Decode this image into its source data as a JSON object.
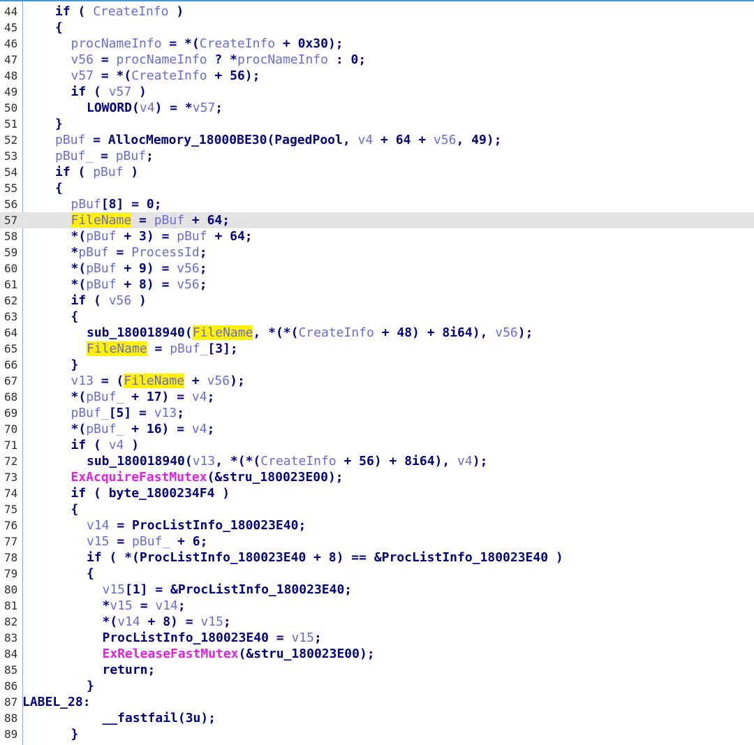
{
  "editor": {
    "colors": {
      "keyword": "#000080",
      "variable": "#6b6bd6",
      "import_function": "#e022e0",
      "highlight": "#fff200",
      "current_line": "#e4e4e4"
    },
    "highlighted_identifier": "FileName",
    "current_line_number": "57",
    "lines": [
      {
        "n": "44",
        "indent": 2,
        "tokens": [
          [
            "kw",
            "if"
          ],
          [
            "punc",
            " ( "
          ],
          [
            "var",
            "CreateInfo"
          ],
          [
            "punc",
            " )"
          ]
        ]
      },
      {
        "n": "45",
        "indent": 2,
        "tokens": [
          [
            "punc",
            "{"
          ]
        ]
      },
      {
        "n": "46",
        "indent": 3,
        "tokens": [
          [
            "var",
            "procNameInfo"
          ],
          [
            "punc",
            " = *("
          ],
          [
            "var",
            "CreateInfo"
          ],
          [
            "punc",
            " + 0x30);"
          ]
        ]
      },
      {
        "n": "47",
        "indent": 3,
        "tokens": [
          [
            "var",
            "v56"
          ],
          [
            "punc",
            " = "
          ],
          [
            "var",
            "procNameInfo"
          ],
          [
            "punc",
            " ? *"
          ],
          [
            "var",
            "procNameInfo"
          ],
          [
            "punc",
            " : 0;"
          ]
        ]
      },
      {
        "n": "48",
        "indent": 3,
        "tokens": [
          [
            "var",
            "v57"
          ],
          [
            "punc",
            " = *("
          ],
          [
            "var",
            "CreateInfo"
          ],
          [
            "punc",
            " + 56);"
          ]
        ]
      },
      {
        "n": "49",
        "indent": 3,
        "tokens": [
          [
            "kw",
            "if"
          ],
          [
            "punc",
            " ( "
          ],
          [
            "var",
            "v57"
          ],
          [
            "punc",
            " )"
          ]
        ]
      },
      {
        "n": "50",
        "indent": 4,
        "tokens": [
          [
            "fn",
            "LOWORD"
          ],
          [
            "punc",
            "("
          ],
          [
            "var",
            "v4"
          ],
          [
            "punc",
            ") = *"
          ],
          [
            "var",
            "v57"
          ],
          [
            "punc",
            ";"
          ]
        ]
      },
      {
        "n": "51",
        "indent": 2,
        "tokens": [
          [
            "punc",
            "}"
          ]
        ]
      },
      {
        "n": "52",
        "indent": 2,
        "tokens": [
          [
            "var",
            "pBuf"
          ],
          [
            "punc",
            " = "
          ],
          [
            "fn",
            "AllocMemory_18000BE30"
          ],
          [
            "punc",
            "("
          ],
          [
            "fn",
            "PagedPool"
          ],
          [
            "punc",
            ", "
          ],
          [
            "var",
            "v4"
          ],
          [
            "punc",
            " + 64 + "
          ],
          [
            "var",
            "v56"
          ],
          [
            "punc",
            ", 49);"
          ]
        ]
      },
      {
        "n": "53",
        "indent": 2,
        "tokens": [
          [
            "var",
            "pBuf_"
          ],
          [
            "punc",
            " = "
          ],
          [
            "var",
            "pBuf"
          ],
          [
            "punc",
            ";"
          ]
        ]
      },
      {
        "n": "54",
        "indent": 2,
        "tokens": [
          [
            "kw",
            "if"
          ],
          [
            "punc",
            " ( "
          ],
          [
            "var",
            "pBuf"
          ],
          [
            "punc",
            " )"
          ]
        ]
      },
      {
        "n": "55",
        "indent": 2,
        "tokens": [
          [
            "punc",
            "{"
          ]
        ]
      },
      {
        "n": "56",
        "indent": 3,
        "tokens": [
          [
            "var",
            "pBuf"
          ],
          [
            "punc",
            "[8] = 0;"
          ]
        ]
      },
      {
        "n": "57",
        "indent": 3,
        "tokens": [
          [
            "hl",
            "FileName"
          ],
          [
            "punc",
            " = "
          ],
          [
            "var",
            "pBuf"
          ],
          [
            "punc",
            " + 64;"
          ]
        ]
      },
      {
        "n": "58",
        "indent": 3,
        "tokens": [
          [
            "punc",
            "*("
          ],
          [
            "var",
            "pBuf"
          ],
          [
            "punc",
            " + 3) = "
          ],
          [
            "var",
            "pBuf"
          ],
          [
            "punc",
            " + 64;"
          ]
        ]
      },
      {
        "n": "59",
        "indent": 3,
        "tokens": [
          [
            "punc",
            "*"
          ],
          [
            "var",
            "pBuf"
          ],
          [
            "punc",
            " = "
          ],
          [
            "var",
            "ProcessId"
          ],
          [
            "punc",
            ";"
          ]
        ]
      },
      {
        "n": "60",
        "indent": 3,
        "tokens": [
          [
            "punc",
            "*("
          ],
          [
            "var",
            "pBuf"
          ],
          [
            "punc",
            " + 9) = "
          ],
          [
            "var",
            "v56"
          ],
          [
            "punc",
            ";"
          ]
        ]
      },
      {
        "n": "61",
        "indent": 3,
        "tokens": [
          [
            "punc",
            "*("
          ],
          [
            "var",
            "pBuf"
          ],
          [
            "punc",
            " + 8) = "
          ],
          [
            "var",
            "v56"
          ],
          [
            "punc",
            ";"
          ]
        ]
      },
      {
        "n": "62",
        "indent": 3,
        "tokens": [
          [
            "kw",
            "if"
          ],
          [
            "punc",
            " ( "
          ],
          [
            "var",
            "v56"
          ],
          [
            "punc",
            " )"
          ]
        ]
      },
      {
        "n": "63",
        "indent": 3,
        "tokens": [
          [
            "punc",
            "{"
          ]
        ]
      },
      {
        "n": "64",
        "indent": 4,
        "tokens": [
          [
            "fn",
            "sub_180018940"
          ],
          [
            "punc",
            "("
          ],
          [
            "hl",
            "FileName"
          ],
          [
            "punc",
            ", *(*("
          ],
          [
            "var",
            "CreateInfo"
          ],
          [
            "punc",
            " + 48) + 8i64), "
          ],
          [
            "var",
            "v56"
          ],
          [
            "punc",
            ");"
          ]
        ]
      },
      {
        "n": "65",
        "indent": 4,
        "tokens": [
          [
            "hl",
            "FileName"
          ],
          [
            "punc",
            " = "
          ],
          [
            "var",
            "pBuf_"
          ],
          [
            "punc",
            "[3];"
          ]
        ]
      },
      {
        "n": "66",
        "indent": 3,
        "tokens": [
          [
            "punc",
            "}"
          ]
        ]
      },
      {
        "n": "67",
        "indent": 3,
        "tokens": [
          [
            "var",
            "v13"
          ],
          [
            "punc",
            " = ("
          ],
          [
            "hl",
            "FileName"
          ],
          [
            "punc",
            " + "
          ],
          [
            "var",
            "v56"
          ],
          [
            "punc",
            ");"
          ]
        ]
      },
      {
        "n": "68",
        "indent": 3,
        "tokens": [
          [
            "punc",
            "*("
          ],
          [
            "var",
            "pBuf_"
          ],
          [
            "punc",
            " + 17) = "
          ],
          [
            "var",
            "v4"
          ],
          [
            "punc",
            ";"
          ]
        ]
      },
      {
        "n": "69",
        "indent": 3,
        "tokens": [
          [
            "var",
            "pBuf_"
          ],
          [
            "punc",
            "[5] = "
          ],
          [
            "var",
            "v13"
          ],
          [
            "punc",
            ";"
          ]
        ]
      },
      {
        "n": "70",
        "indent": 3,
        "tokens": [
          [
            "punc",
            "*("
          ],
          [
            "var",
            "pBuf_"
          ],
          [
            "punc",
            " + 16) = "
          ],
          [
            "var",
            "v4"
          ],
          [
            "punc",
            ";"
          ]
        ]
      },
      {
        "n": "71",
        "indent": 3,
        "tokens": [
          [
            "kw",
            "if"
          ],
          [
            "punc",
            " ( "
          ],
          [
            "var",
            "v4"
          ],
          [
            "punc",
            " )"
          ]
        ]
      },
      {
        "n": "72",
        "indent": 4,
        "tokens": [
          [
            "fn",
            "sub_180018940"
          ],
          [
            "punc",
            "("
          ],
          [
            "var",
            "v13"
          ],
          [
            "punc",
            ", *(*("
          ],
          [
            "var",
            "CreateInfo"
          ],
          [
            "punc",
            " + 56) + 8i64), "
          ],
          [
            "var",
            "v4"
          ],
          [
            "punc",
            ");"
          ]
        ]
      },
      {
        "n": "73",
        "indent": 3,
        "tokens": [
          [
            "imp",
            "ExAcquireFastMutex"
          ],
          [
            "punc",
            "(&stru_180023E00);"
          ]
        ]
      },
      {
        "n": "74",
        "indent": 3,
        "tokens": [
          [
            "kw",
            "if"
          ],
          [
            "punc",
            " ( byte_1800234F4 )"
          ]
        ]
      },
      {
        "n": "75",
        "indent": 3,
        "tokens": [
          [
            "punc",
            "{"
          ]
        ]
      },
      {
        "n": "76",
        "indent": 4,
        "tokens": [
          [
            "var",
            "v14"
          ],
          [
            "punc",
            " = ProcListInfo_180023E40;"
          ]
        ]
      },
      {
        "n": "77",
        "indent": 4,
        "tokens": [
          [
            "var",
            "v15"
          ],
          [
            "punc",
            " = "
          ],
          [
            "var",
            "pBuf_"
          ],
          [
            "punc",
            " + 6;"
          ]
        ]
      },
      {
        "n": "78",
        "indent": 4,
        "tokens": [
          [
            "kw",
            "if"
          ],
          [
            "punc",
            " ( *(ProcListInfo_180023E40 + 8) == &ProcListInfo_180023E40 )"
          ]
        ]
      },
      {
        "n": "79",
        "indent": 4,
        "tokens": [
          [
            "punc",
            "{"
          ]
        ]
      },
      {
        "n": "80",
        "indent": 5,
        "tokens": [
          [
            "var",
            "v15"
          ],
          [
            "punc",
            "[1] = &ProcListInfo_180023E40;"
          ]
        ]
      },
      {
        "n": "81",
        "indent": 5,
        "tokens": [
          [
            "punc",
            "*"
          ],
          [
            "var",
            "v15"
          ],
          [
            "punc",
            " = "
          ],
          [
            "var",
            "v14"
          ],
          [
            "punc",
            ";"
          ]
        ]
      },
      {
        "n": "82",
        "indent": 5,
        "tokens": [
          [
            "punc",
            "*("
          ],
          [
            "var",
            "v14"
          ],
          [
            "punc",
            " + 8) = "
          ],
          [
            "var",
            "v15"
          ],
          [
            "punc",
            ";"
          ]
        ]
      },
      {
        "n": "83",
        "indent": 5,
        "tokens": [
          [
            "punc",
            "ProcListInfo_180023E40 = "
          ],
          [
            "var",
            "v15"
          ],
          [
            "punc",
            ";"
          ]
        ]
      },
      {
        "n": "84",
        "indent": 5,
        "tokens": [
          [
            "imp",
            "ExReleaseFastMutex"
          ],
          [
            "punc",
            "(&stru_180023E00);"
          ]
        ]
      },
      {
        "n": "85",
        "indent": 5,
        "tokens": [
          [
            "kw",
            "return"
          ],
          [
            "punc",
            ";"
          ]
        ]
      },
      {
        "n": "86",
        "indent": 4,
        "tokens": [
          [
            "punc",
            "}"
          ]
        ]
      },
      {
        "n": "87",
        "indent": 0,
        "tokens": [
          [
            "lbl",
            "LABEL_28"
          ],
          [
            "punc",
            ":"
          ]
        ]
      },
      {
        "n": "88",
        "indent": 5,
        "tokens": [
          [
            "fn",
            "__fastfail"
          ],
          [
            "punc",
            "(3u);"
          ]
        ]
      },
      {
        "n": "89",
        "indent": 3,
        "tokens": [
          [
            "punc",
            "}"
          ]
        ]
      }
    ]
  }
}
